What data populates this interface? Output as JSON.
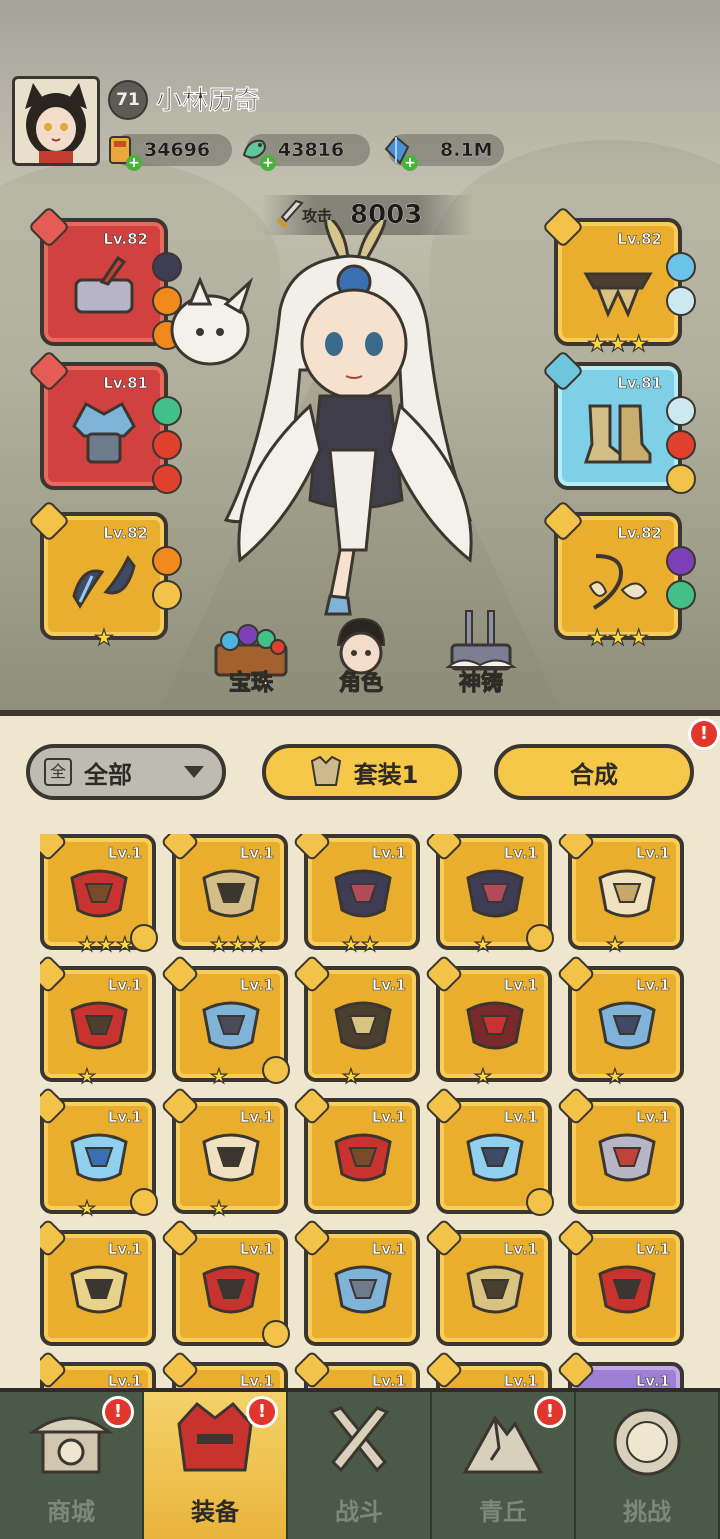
{
  "player": {
    "level": "71",
    "name": "小林历奇"
  },
  "resources": [
    {
      "icon": "scroll-ticket-icon",
      "value": "34696"
    },
    {
      "icon": "jade-dragon-icon",
      "value": "43816"
    },
    {
      "icon": "blue-crystal-icon",
      "value": "8.1M"
    }
  ],
  "attack": {
    "label": "攻击",
    "value": "8003"
  },
  "equipped": {
    "weapon": {
      "level": "Lv.82",
      "stars": 0
    },
    "armor": {
      "level": "Lv.81",
      "stars": 0
    },
    "ring": {
      "level": "Lv.82",
      "stars": 1
    },
    "waist": {
      "level": "Lv.82",
      "stars": 3
    },
    "boots": {
      "level": "Lv.81",
      "stars": 0
    },
    "accessory": {
      "level": "Lv.82",
      "stars": 3
    }
  },
  "scene_buttons": {
    "pearls": "宝珠",
    "character": "角色",
    "forge": "神铸"
  },
  "toolbar": {
    "filter_icon_label": "全",
    "filter_label": "全部",
    "set_label": "套装1",
    "merge_label": "合成",
    "alert_mark": "!"
  },
  "inventory": [
    {
      "level": "Lv.1",
      "stars": 3,
      "locked": true,
      "icon": "red-flower-ring-icon"
    },
    {
      "level": "Lv.1",
      "stars": 3,
      "locked": false,
      "icon": "gold-boots-icon"
    },
    {
      "level": "Lv.1",
      "stars": 2,
      "locked": false,
      "icon": "dark-belt-icon"
    },
    {
      "level": "Lv.1",
      "stars": 1,
      "locked": true,
      "icon": "dark-armor-icon"
    },
    {
      "level": "Lv.1",
      "stars": 1,
      "locked": false,
      "icon": "horn-amulet-icon"
    },
    {
      "level": "Lv.1",
      "stars": 1,
      "locked": false,
      "icon": "red-lotus-belt-icon"
    },
    {
      "level": "Lv.1",
      "stars": 1,
      "locked": true,
      "icon": "ice-belt-icon"
    },
    {
      "level": "Lv.1",
      "stars": 1,
      "locked": false,
      "icon": "bronze-belt-icon"
    },
    {
      "level": "Lv.1",
      "stars": 1,
      "locked": false,
      "icon": "red-boots-icon"
    },
    {
      "level": "Lv.1",
      "stars": 1,
      "locked": false,
      "icon": "ice-boots-icon"
    },
    {
      "level": "Lv.1",
      "stars": 1,
      "locked": true,
      "icon": "ice-gem-amulet-icon"
    },
    {
      "level": "Lv.1",
      "stars": 1,
      "locked": false,
      "icon": "bone-amulet-icon"
    },
    {
      "level": "Lv.1",
      "stars": 0,
      "locked": false,
      "icon": "red-flower-ring-icon"
    },
    {
      "level": "Lv.1",
      "stars": 0,
      "locked": true,
      "icon": "ice-bow-icon"
    },
    {
      "level": "Lv.1",
      "stars": 0,
      "locked": false,
      "icon": "stone-hammer-icon"
    },
    {
      "level": "Lv.1",
      "stars": 0,
      "locked": false,
      "icon": "gold-staff-icon"
    },
    {
      "level": "Lv.1",
      "stars": 0,
      "locked": true,
      "icon": "red-helmet-icon"
    },
    {
      "level": "Lv.1",
      "stars": 0,
      "locked": false,
      "icon": "ice-helmet-icon"
    },
    {
      "level": "Lv.1",
      "stars": 0,
      "locked": false,
      "icon": "gold-helmet-icon"
    },
    {
      "level": "Lv.1",
      "stars": 0,
      "locked": false,
      "icon": "red-ring-icon"
    },
    {
      "level": "Lv.1",
      "stars": 0,
      "locked": false,
      "icon": "partial-item-icon"
    },
    {
      "level": "Lv.1",
      "stars": 0,
      "locked": false,
      "icon": "partial-item-icon"
    },
    {
      "level": "Lv.1",
      "stars": 0,
      "locked": false,
      "icon": "partial-item-icon"
    },
    {
      "level": "Lv.1",
      "stars": 0,
      "locked": false,
      "icon": "partial-item-icon"
    },
    {
      "level": "Lv.1",
      "stars": 0,
      "locked": false,
      "icon": "partial-item-icon"
    }
  ],
  "nav": [
    {
      "label": "商城",
      "icon": "shop-pagoda-icon",
      "alert": true,
      "active": false
    },
    {
      "label": "装备",
      "icon": "red-helmet-icon",
      "alert": true,
      "active": true
    },
    {
      "label": "战斗",
      "icon": "crossed-swords-icon",
      "alert": false,
      "active": false
    },
    {
      "label": "青丘",
      "icon": "mountain-icon",
      "alert": true,
      "active": false
    },
    {
      "label": "挑战",
      "icon": "orb-icon",
      "alert": false,
      "active": false
    }
  ],
  "colors": {
    "gold_slot": "#e9ae2d",
    "red_slot": "#d0413f",
    "cyan_slot": "#7fd0e7",
    "purple_slot": "#9d7fd6",
    "outline": "#3b3630",
    "nav_bg": "#4a5a47",
    "alert": "#e2352c"
  }
}
